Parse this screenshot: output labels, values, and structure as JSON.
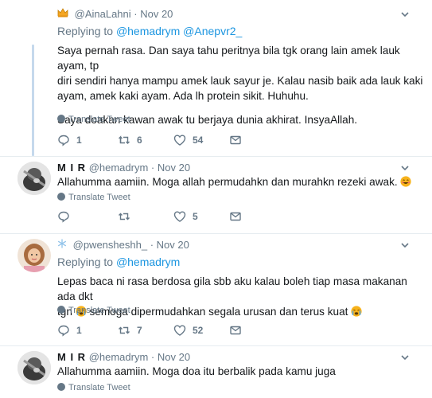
{
  "tweets": [
    {
      "handle": "@AinaLahni",
      "time": "· Nov 20",
      "replying_prefix": "Replying to",
      "mentions": [
        "@hemadrym",
        "@Anepvr2_"
      ],
      "lines": [
        "Saya pernah rasa. Dan saya tahu peritnya bila tgk orang lain amek lauk ayam, tp",
        "diri sendiri hanya mampu amek lauk sayur je. Kalau nasib baik ada lauk kaki",
        "ayam, amek kaki ayam. Ada lh protein sikit. Huhuhu.",
        "",
        "Saya doakan kawan awak tu berjaya dunia akhirat. InsyaAllah."
      ],
      "translate": "Translate Tweet",
      "replies": "1",
      "retweets": "6",
      "likes": "54"
    },
    {
      "name": "M I R",
      "handle": "@hemadrym",
      "time": "· Nov 20",
      "text": "Allahumma aamiin. Moga allah permudahkn dan murahkn rezeki awak.",
      "translate": "Translate Tweet",
      "replies": "",
      "retweets": "",
      "likes": "5"
    },
    {
      "handle": "@pwensheshh_",
      "time": "· Nov 20",
      "replying_prefix": "Replying to",
      "mentions": [
        "@hemadrym"
      ],
      "line1": "Lepas baca ni rasa berdosa gila sbb aku kalau boleh tiap masa makanan ada dkt",
      "line2a": "tgn",
      "line2b": "semoga dipermudahkan segala urusan dan terus kuat",
      "translate": "Translate Tweet",
      "replies": "1",
      "retweets": "7",
      "likes": "52"
    },
    {
      "name": "M I R",
      "handle": "@hemadrym",
      "time": "· Nov 20",
      "text": "Allahumma aamiin. Moga doa itu berbalik pada kamu juga",
      "translate": "Translate Tweet"
    }
  ],
  "colors": {
    "link": "#1b95e0",
    "muted": "#657786",
    "text": "#14171a",
    "divider": "#e6ecf0",
    "thread": "#c5d9ec"
  }
}
